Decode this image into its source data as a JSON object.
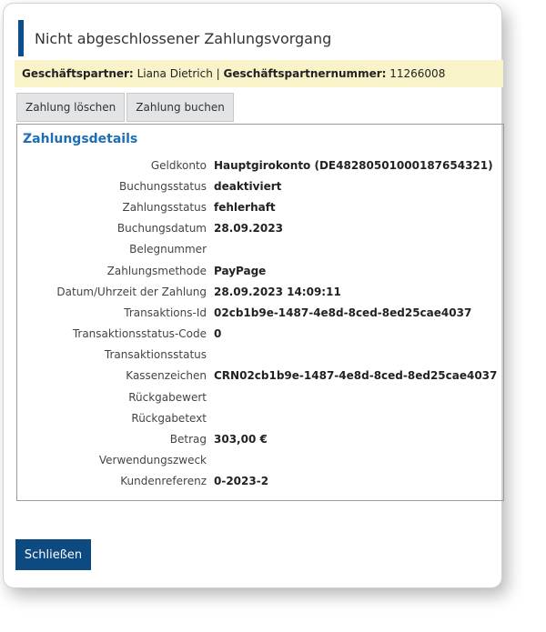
{
  "dialog": {
    "title": "Nicht abgeschlossener Zahlungsvorgang"
  },
  "partner": {
    "partner_label": "Geschäftspartner:",
    "partner_name": "Liana Dietrich",
    "separator": "|",
    "number_label": "Geschäftspartnernummer:",
    "number_value": "11266008"
  },
  "toolbar": {
    "delete_label": "Zahlung löschen",
    "book_label": "Zahlung buchen"
  },
  "details": {
    "heading": "Zahlungsdetails",
    "rows": [
      {
        "label": "Geldkonto",
        "value": "Hauptgirokonto (DE48280501000187654321)"
      },
      {
        "label": "Buchungsstatus",
        "value": "deaktiviert"
      },
      {
        "label": "Zahlungsstatus",
        "value": "fehlerhaft"
      },
      {
        "label": "Buchungsdatum",
        "value": "28.09.2023"
      },
      {
        "label": "Belegnummer",
        "value": ""
      },
      {
        "label": "Zahlungsmethode",
        "value": "PayPage"
      },
      {
        "label": "Datum/Uhrzeit der Zahlung",
        "value": "28.09.2023 14:09:11"
      },
      {
        "label": "Transaktions-Id",
        "value": "02cb1b9e-1487-4e8d-8ced-8ed25cae4037"
      },
      {
        "label": "Transaktionsstatus-Code",
        "value": "0"
      },
      {
        "label": "Transaktionsstatus",
        "value": ""
      },
      {
        "label": "Kassenzeichen",
        "value": "CRN02cb1b9e-1487-4e8d-8ced-8ed25cae4037"
      },
      {
        "label": "Rückgabewert",
        "value": ""
      },
      {
        "label": "Rückgabetext",
        "value": ""
      },
      {
        "label": "Betrag",
        "value": "303,00 €"
      },
      {
        "label": "Verwendungszweck",
        "value": ""
      },
      {
        "label": "Kundenreferenz",
        "value": "0-2023-2"
      }
    ]
  },
  "footer": {
    "close_label": "Schließen"
  },
  "colors": {
    "accent": "#0f4d8a",
    "heading": "#1e6eb5",
    "partner_bar": "#f8f3c8",
    "close_button": "#0d4a82"
  }
}
